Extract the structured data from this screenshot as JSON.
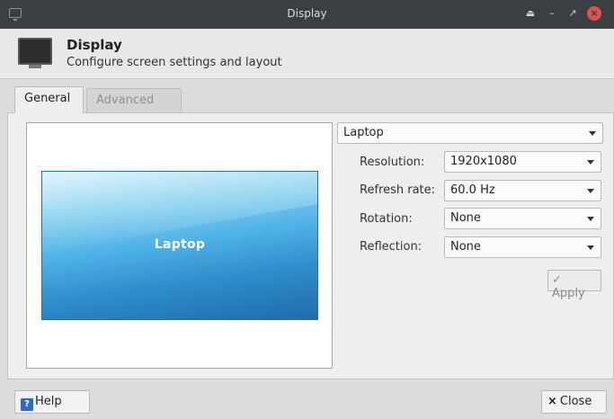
{
  "window": {
    "title": "Display"
  },
  "header": {
    "title": "Display",
    "subtitle": "Configure screen settings and layout"
  },
  "tabs": [
    {
      "label": "General",
      "active": true
    },
    {
      "label": "Advanced",
      "active": false
    }
  ],
  "preview": {
    "screen_label": "Laptop"
  },
  "settings": {
    "display_select": "Laptop",
    "resolution": {
      "label": "Resolution:",
      "value": "1920x1080"
    },
    "refresh_rate": {
      "label": "Refresh rate:",
      "value": "60.0 Hz"
    },
    "rotation": {
      "label": "Rotation:",
      "value": "None"
    },
    "reflection": {
      "label": "Reflection:",
      "value": "None"
    },
    "apply_label": "Apply"
  },
  "footer": {
    "help_label": "Help",
    "close_label": "Close"
  },
  "colors": {
    "titlebar": "#3a3f44",
    "close_button": "#e0524f",
    "screen_top": "#cfeefb",
    "screen_bottom": "#1f6cab",
    "help_icon": "#2e6bc6"
  }
}
